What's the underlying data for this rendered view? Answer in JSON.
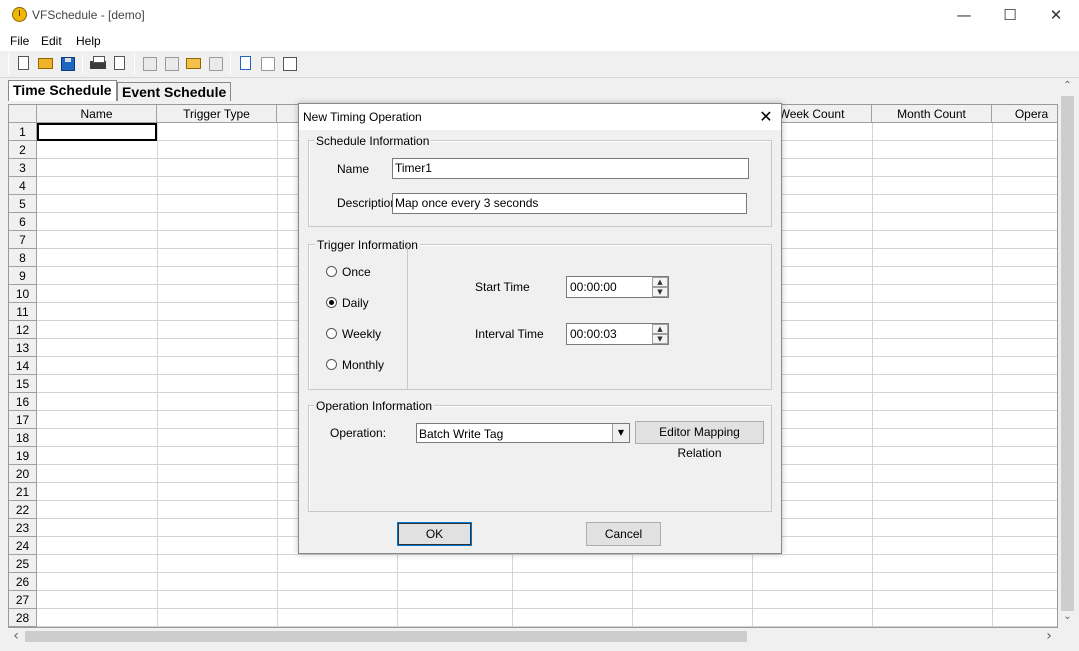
{
  "window": {
    "title": "VFSchedule - [demo]",
    "minimize_glyph": "—",
    "maximize_glyph": "☐",
    "close_glyph": "✕"
  },
  "menu": [
    "File",
    "Edit",
    "Help"
  ],
  "toolbar_icons": [
    "new-doc-icon",
    "open-folder-icon",
    "save-icon",
    "print-icon",
    "print-preview-icon",
    "cut-icon",
    "copy-icon",
    "paste-icon",
    "delete-icon",
    "schedule-icon",
    "add-row-icon",
    "code-icon"
  ],
  "tabs": [
    "Time Schedule",
    "Event Schedule"
  ],
  "grid": {
    "columns": [
      "Name",
      "Trigger Type",
      "",
      "",
      "",
      "",
      "Week Count",
      "Month Count",
      "Opera"
    ],
    "rows": [
      "1",
      "2",
      "3",
      "4",
      "5",
      "6",
      "7",
      "8",
      "9",
      "10",
      "11",
      "12",
      "13",
      "14",
      "15",
      "16",
      "17",
      "18",
      "19",
      "20",
      "21",
      "22",
      "23",
      "24",
      "25",
      "26",
      "27",
      "28"
    ]
  },
  "scroll_arrows": {
    "up": "⌃",
    "down": "⌄",
    "left": "‹",
    "right": "›"
  },
  "dialog": {
    "title": "New Timing Operation",
    "close_glyph": "✕",
    "schedule_group": "Schedule Information",
    "name_label": "Name",
    "name_value": "Timer1",
    "description_label": "Description",
    "description_value": "Map once every 3 seconds",
    "trigger_group": "Trigger Information",
    "radio_options": [
      "Once",
      "Daily",
      "Weekly",
      "Monthly"
    ],
    "selected_option": "Daily",
    "start_time_label": "Start Time",
    "start_time_value": "00:00:00",
    "interval_time_label": "Interval Time",
    "interval_time_value": "00:00:03",
    "operation_group": "Operation Information",
    "operation_label": "Operation:",
    "operation_value": "Batch Write Tag",
    "editor_button": "Editor Mapping Relation",
    "ok_button": "OK",
    "cancel_button": "Cancel",
    "spin_up": "▲",
    "spin_down": "▼",
    "combo_arrow": "▼"
  }
}
